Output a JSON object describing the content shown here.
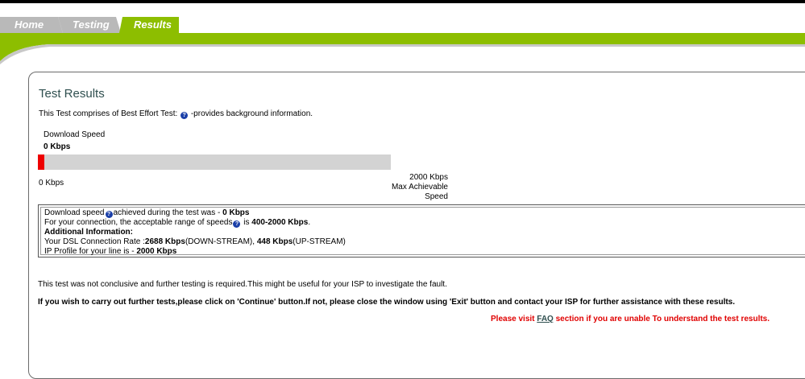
{
  "nav": {
    "tabs": [
      {
        "label": "Home",
        "active": false
      },
      {
        "label": "Testing",
        "active": false
      },
      {
        "label": "Results",
        "active": true
      }
    ]
  },
  "colors": {
    "accent_green": "#8dbe00",
    "inactive_tab": "#b9b9b9",
    "meter_fill": "#ee0000",
    "meter_track": "#d3d3d3",
    "warning_text": "#e00000"
  },
  "results": {
    "title": "Test Results",
    "intro_before_icon": "This Test comprises of Best Effort Test: ",
    "intro_after_icon": " -provides background information.",
    "download_label": "Download  Speed",
    "download_value": "0 Kbps",
    "meter": {
      "value_kbps": 0,
      "max_kbps": 2000,
      "min_label": "0 Kbps",
      "max_value_label": "2000 Kbps",
      "max_caption": "Max Achievable Speed"
    }
  },
  "info": {
    "line1_a": "Download speed",
    "line1_b": "achieved during the test was - ",
    "line1_val": "0 Kbps",
    "line2_a": "For your connection, the acceptable range of speeds",
    "line2_b": " is ",
    "line2_val": "400-2000 Kbps",
    "line2_end": ".",
    "additional_heading": "Additional Information:",
    "line4_a": "Your DSL Connection Rate :",
    "line4_down": "2688 Kbps",
    "line4_b": "(DOWN-STREAM), ",
    "line4_up": "448 Kbps",
    "line4_c": "(UP-STREAM)",
    "line5_a": "IP Profile for your line is - ",
    "line5_val": "2000 Kbps"
  },
  "notes": {
    "inconclusive": "This test was not conclusive and further testing is required.This might be useful for your ISP to investigate the fault.",
    "continue_instruction": "If you wish to carry out further tests,please click on 'Continue' button.If not, please close the window using 'Exit' button and contact your ISP for further assistance with these results.",
    "faq_before": "Please visit ",
    "faq_link": "FAQ",
    "faq_after": " section if you are unable To understand the test results."
  },
  "icons": {
    "help": "help-circle-icon",
    "help_glyph": "?"
  }
}
